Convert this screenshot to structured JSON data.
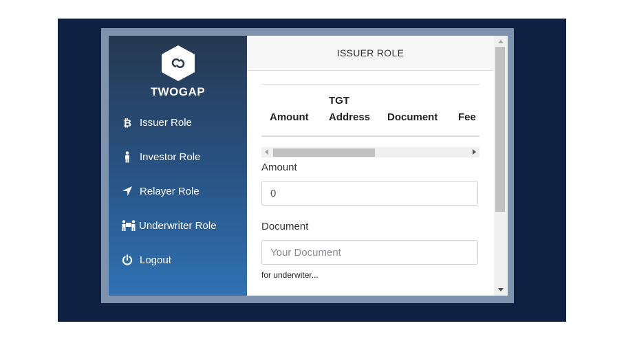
{
  "app": {
    "brand": "TWOGAP"
  },
  "sidebar": {
    "items": [
      {
        "label": "Issuer Role",
        "icon": "bitcoin-icon"
      },
      {
        "label": "Investor Role",
        "icon": "person-icon"
      },
      {
        "label": "Relayer Role",
        "icon": "location-arrow-icon"
      },
      {
        "label": "Underwriter Role",
        "icon": "people-carry-icon"
      },
      {
        "label": "Logout",
        "icon": "power-icon"
      }
    ]
  },
  "main": {
    "title": "ISSUER ROLE",
    "table": {
      "headers": [
        {
          "line1": "",
          "line2": "Amount"
        },
        {
          "line1": "TGT",
          "line2": "Address"
        },
        {
          "line1": "",
          "line2": "Document"
        },
        {
          "line1": "",
          "line2": "Fee"
        }
      ]
    },
    "form": {
      "amount_label": "Amount",
      "amount_value": "0",
      "document_label": "Document",
      "document_placeholder": "Your Document",
      "helper_text": "for underwiter..."
    }
  },
  "colors": {
    "backdrop": "#0e2142",
    "frame": "#7f93ad",
    "sidebar_top": "#263850",
    "sidebar_bottom": "#3072b4"
  }
}
